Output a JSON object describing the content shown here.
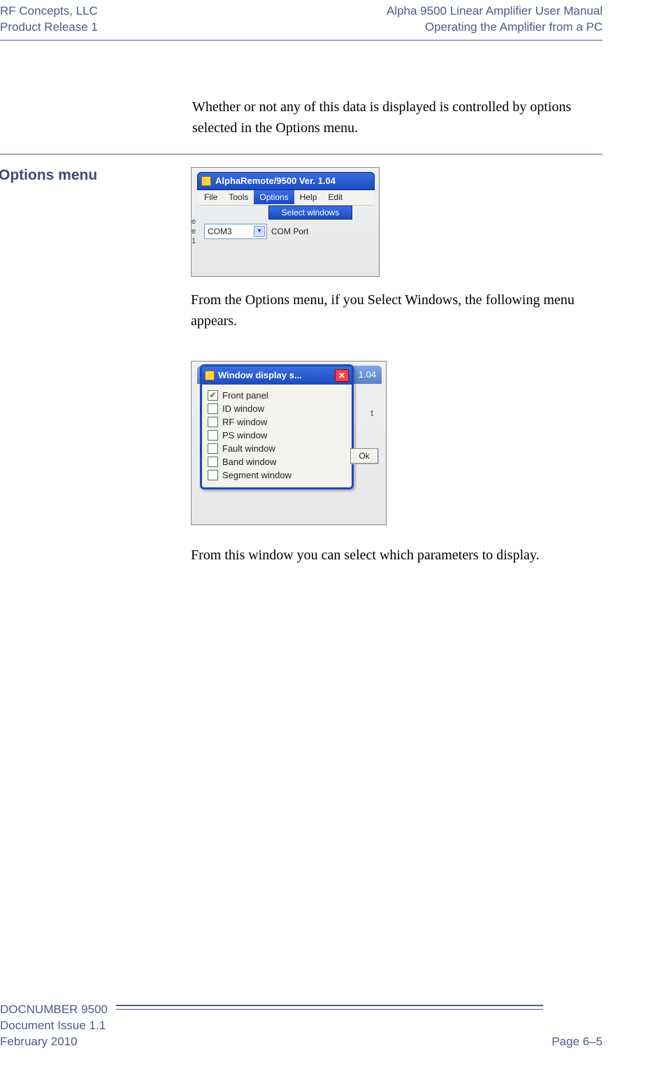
{
  "header": {
    "left1": "RF Concepts, LLC",
    "left2": "Product Release 1",
    "right1": "Alpha 9500 Linear Amplifier User Manual",
    "right2": "Operating the Amplifier from a PC"
  },
  "intro_text": "Whether or not any of this data is displayed is controlled by options selected in the Options menu.",
  "section_heading": "Options menu",
  "screenshot1": {
    "title": "AlphaRemote/9500 Ver. 1.04",
    "menu": {
      "file": "File",
      "tools": "Tools",
      "options": "Options",
      "help": "Help",
      "edit": "Edit"
    },
    "dropdown_item": "Select windows",
    "com_value": "COM3",
    "com_label": "COM Port"
  },
  "body_text1": "From the Options menu, if you Select Windows, the following menu appears.",
  "screenshot2": {
    "bg_title_fragment": "1.04",
    "dialog_title": "Window display s...",
    "checks": [
      {
        "label": "Front panel",
        "checked": true
      },
      {
        "label": "ID window",
        "checked": false
      },
      {
        "label": "RF window",
        "checked": false
      },
      {
        "label": "PS window",
        "checked": false
      },
      {
        "label": "Fault window",
        "checked": false
      },
      {
        "label": "Band window",
        "checked": false
      },
      {
        "label": "Segment window",
        "checked": false
      }
    ],
    "ok_label": "Ok",
    "stray_char": "t"
  },
  "body_text2": "From this window you can select which parameters to display.",
  "footer": {
    "doc": "DOCNUMBER 9500",
    "issue": "Document Issue 1.1",
    "date": "February 2010",
    "page": "Page 6–5"
  }
}
